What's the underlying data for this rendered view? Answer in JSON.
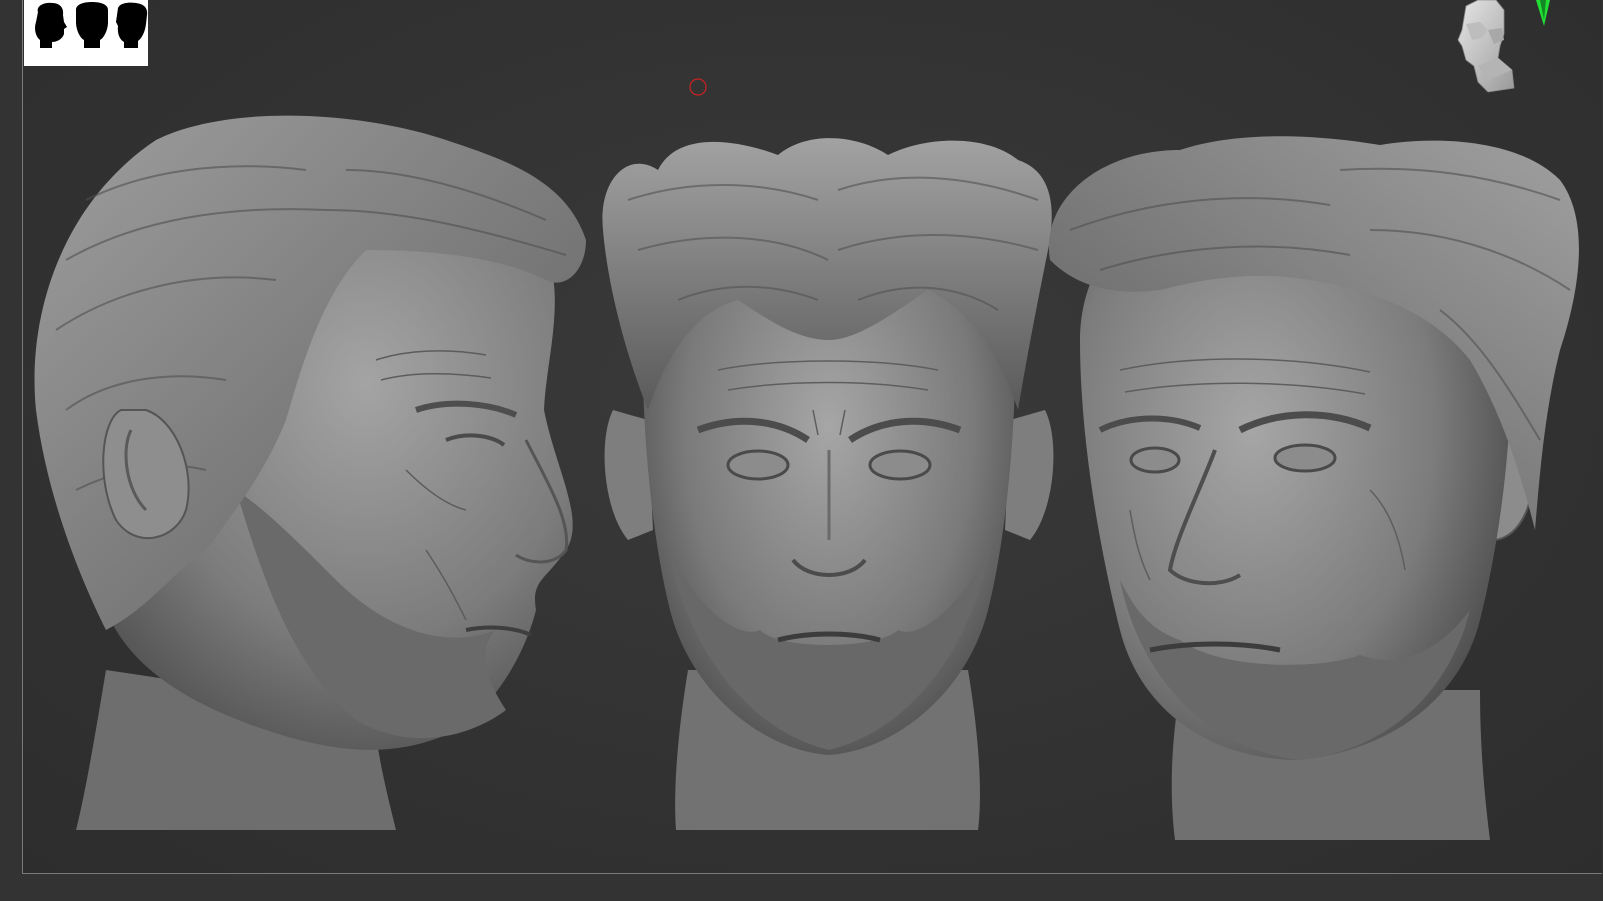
{
  "app": {
    "background_color": "#333333",
    "frame_color": "#7a7a7a",
    "thumbnail_background": "#ffffff",
    "cursor_marker_color": "#cc2222",
    "axis_gizmo_color": "#22dd33",
    "sculpt_material_color": "#8a8a8a"
  },
  "canvas": {
    "views": [
      {
        "view": "side-profile",
        "facing": "right"
      },
      {
        "view": "front"
      },
      {
        "view": "three-quarter",
        "facing": "left"
      }
    ]
  },
  "icons": {
    "thumbnail": "silhouette-thumbnail-icon",
    "orientation": "head-orientation-icon",
    "axis": "axis-gizmo-icon",
    "cursor": "brush-cursor-icon"
  }
}
